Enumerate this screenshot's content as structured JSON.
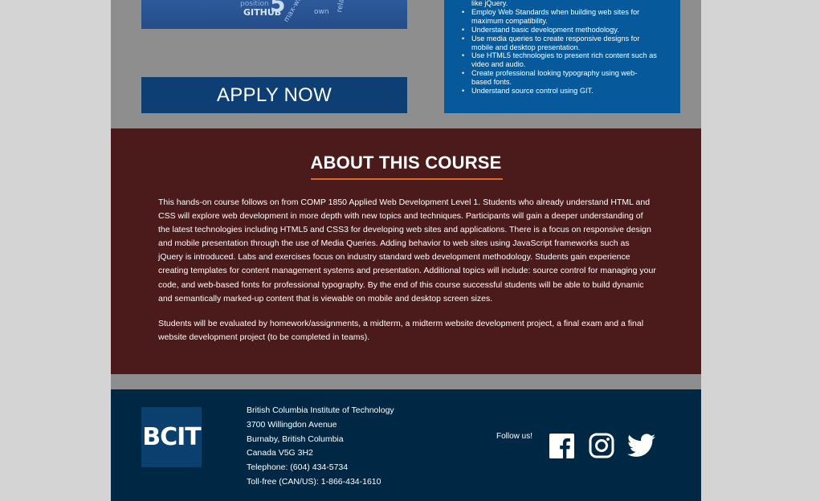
{
  "hero": {
    "words": [
      "position",
      "GITHUB",
      "5",
      "max-wi",
      "own",
      "rela"
    ]
  },
  "apply": {
    "label": "APPLY NOW"
  },
  "outcomes": {
    "items": [
      {
        "text": "like jQuery.",
        "continuation": true
      },
      {
        "text": "Employ Web Standards when building web sites for",
        "continuation": false
      },
      {
        "text": "maximum compatibility.",
        "continuation": true
      },
      {
        "text": "Understand basic development methodology.",
        "continuation": false
      },
      {
        "text": "Use media queries to create responsive designs for",
        "continuation": false
      },
      {
        "text": "mobile and desktop presentation.",
        "continuation": true
      },
      {
        "text": "Use HTML5 technologies to present rich content such as",
        "continuation": false
      },
      {
        "text": "video and audio.",
        "continuation": true
      },
      {
        "text": "Create professional looking typography using web-",
        "continuation": false
      },
      {
        "text": "based fonts.",
        "continuation": true
      },
      {
        "text": "Understand source control using GIT.",
        "continuation": false
      }
    ]
  },
  "about": {
    "title": "ABOUT THIS COURSE",
    "paragraph1": "This hands-on course follows on from COMP 1850 Applied Web Development Level 1. Students who already understand HTML and CSS will explore web development in more depth with new topics and techniques. Participants will gain a deeper understanding of the latest technologies including HTML5 and CSS3 for developing web sites and applications. There is a focus on responsive design and mobile presentation through the use of Media Queries. Adding behavior to web sites using JavaScript frameworks such as jQuery is introduced. Labs and exercises focus on industry standard web development methodology. Students gain experience creating templates for content management systems and presentation. Additional topics will include: source control for managing your code, and web-based fonts for professional typography. By the end of this course successful students will be able to build dynamic and semantically marked-up content that is viewable on mobile and desktop screen sizes.",
    "paragraph2": "Students will be evaluated by homework/assignments, a midterm, a midterm website development project, a final exam and a final website development project (to be completed in teams)."
  },
  "footer": {
    "logo": "BCIT",
    "address": [
      "British Columbia Institute of Technology",
      "3700 Willingdon Avenue",
      "Burnaby, British Columbia",
      "Canada V5G 3H2",
      "Telephone: (604) 434-5734",
      "Toll-free (CAN/US): 1-866-434-1610"
    ],
    "follow_label": "Follow us!",
    "social": [
      "facebook-icon",
      "instagram-icon",
      "twitter-icon"
    ]
  },
  "colors": {
    "page_bg": "#d4d4d4",
    "gray_band": "#8e8e8e",
    "apply_bg": "#0d3f74",
    "outcomes_bg": "#065a9c",
    "about_bg": "#4b1a1a",
    "accent_rule": "#e0692e",
    "footer_bg": "#002844",
    "logo_bg": "#0a3f6e"
  }
}
